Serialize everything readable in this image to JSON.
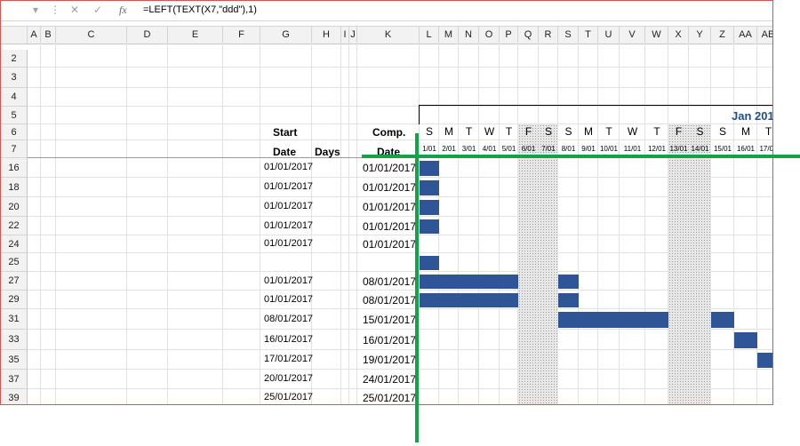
{
  "formula_bar": {
    "formula": "=LEFT(TEXT(X7,\"ddd\"),1)",
    "fx_label": "fx",
    "cancel": "✕",
    "enter": "✓",
    "more": "⋮"
  },
  "columns": [
    "A",
    "B",
    "C",
    "D",
    "E",
    "F",
    "G",
    "H",
    "I",
    "J",
    "K",
    "L",
    "M",
    "N",
    "O",
    "P",
    "Q",
    "R",
    "S",
    "T",
    "U",
    "V",
    "W",
    "X",
    "Y",
    "Z",
    "AA",
    "AB"
  ],
  "rows": [
    "2",
    "3",
    "4",
    "5",
    "6",
    "7",
    "16",
    "18",
    "20",
    "22",
    "24",
    "25",
    "27",
    "29",
    "31",
    "33",
    "35",
    "37",
    "39"
  ],
  "headers": {
    "start_1": "Start",
    "start_2": "Date",
    "days": "Days",
    "comp_1": "Comp.",
    "comp_2": "Date",
    "month": "Jan 201"
  },
  "day_letters": [
    "S",
    "M",
    "T",
    "W",
    "T",
    "F",
    "S",
    "S",
    "M",
    "T",
    "W",
    "T",
    "F",
    "S",
    "S",
    "M",
    "T"
  ],
  "day_numbers": [
    "1/01",
    "2/01",
    "3/01",
    "4/01",
    "5/01",
    "6/01",
    "7/01",
    "8/01",
    "9/01",
    "10/01",
    "11/01",
    "12/01",
    "13/01",
    "14/01",
    "15/01",
    "16/01",
    "17/01"
  ],
  "tasks": [
    {
      "row": "16",
      "start": "01/01/2017",
      "comp": "01/01/2017",
      "bar_start": 0,
      "bar_days": 1
    },
    {
      "row": "18",
      "start": "01/01/2017",
      "comp": "01/01/2017",
      "bar_start": 0,
      "bar_days": 1
    },
    {
      "row": "20",
      "start": "01/01/2017",
      "comp": "01/01/2017",
      "bar_start": 0,
      "bar_days": 1
    },
    {
      "row": "22",
      "start": "01/01/2017",
      "comp": "01/01/2017",
      "bar_start": 0,
      "bar_days": 1
    },
    {
      "row": "24",
      "start": "01/01/2017",
      "comp": "01/01/2017",
      "bar_start": null,
      "bar_days": 0
    },
    {
      "row": "25",
      "start": "",
      "comp": "",
      "bar_start": 0,
      "bar_days": 1
    },
    {
      "row": "27",
      "start": "01/01/2017",
      "comp": "08/01/2017",
      "bar_start": 0,
      "bar_days": 8
    },
    {
      "row": "29",
      "start": "01/01/2017",
      "comp": "08/01/2017",
      "bar_start": 0,
      "bar_days": 8
    },
    {
      "row": "31",
      "start": "08/01/2017",
      "comp": "15/01/2017",
      "bar_start": 7,
      "bar_days": 8
    },
    {
      "row": "33",
      "start": "16/01/2017",
      "comp": "16/01/2017",
      "bar_start": 15,
      "bar_days": 1
    },
    {
      "row": "35",
      "start": "17/01/2017",
      "comp": "19/01/2017",
      "bar_start": 16,
      "bar_days": 3
    },
    {
      "row": "37",
      "start": "20/01/2017",
      "comp": "24/01/2017",
      "bar_start": null,
      "bar_days": 0
    },
    {
      "row": "39",
      "start": "25/01/2017",
      "comp": "25/01/2017",
      "bar_start": null,
      "bar_days": 0
    }
  ],
  "colors": {
    "bar": "#2f5597",
    "guide": "#15a246",
    "month": "#1f4e8c"
  }
}
